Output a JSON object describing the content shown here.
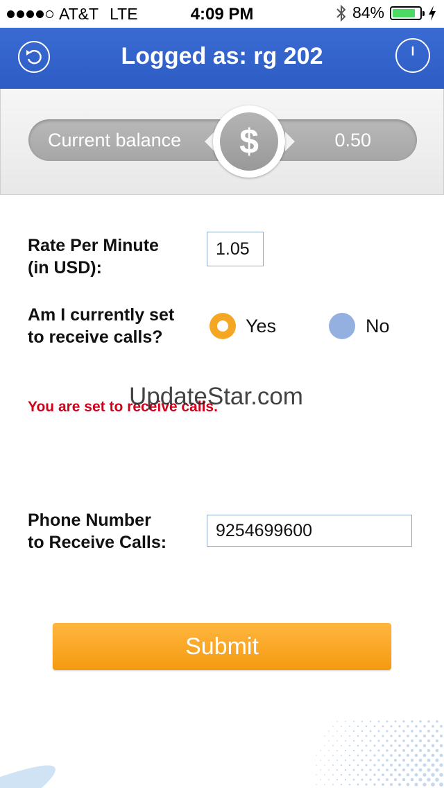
{
  "status_bar": {
    "carrier": "AT&T",
    "network": "LTE",
    "time": "4:09 PM",
    "battery_percent": "84%",
    "battery_level": 0.84,
    "signal_bars": 4
  },
  "header": {
    "title": "Logged as: rg 202",
    "back_icon": "refresh-back-icon",
    "power_icon": "power-icon",
    "background": "#2f5fc8"
  },
  "balance": {
    "label": "Current balance",
    "value": "0.50",
    "symbol": "$"
  },
  "form": {
    "rate_label_line1": "Rate Per Minute",
    "rate_label_line2": "(in USD):",
    "rate_value": "1.05",
    "receive_label_line1": "Am I currently set",
    "receive_label_line2": "to receive calls?",
    "yes_label": "Yes",
    "no_label": "No",
    "selected": "Yes",
    "notice": "You are set to receive calls.",
    "phone_label_line1": "Phone Number",
    "phone_label_line2": "to Receive Calls:",
    "phone_value": "9254699600",
    "submit_label": "Submit"
  },
  "watermark": "UpdateStar.com",
  "colors": {
    "accent_orange": "#f5a623",
    "notice_red": "#d0021b",
    "radio_off": "#94b0e0"
  }
}
